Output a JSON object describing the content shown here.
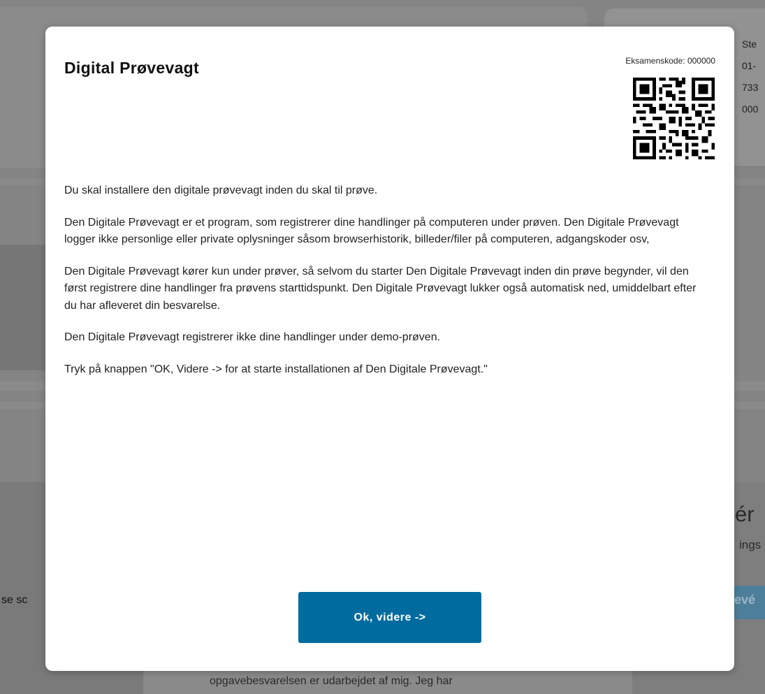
{
  "background": {
    "info_lines": [
      "Ste",
      "01-",
      "733",
      "000"
    ],
    "big_text": "ér",
    "small_text": "ings",
    "button_label": "evé",
    "left_text": "se sc",
    "bottom_text": "opgavebesvarelsen er udarbejdet af mig. Jeg har"
  },
  "modal": {
    "title": "Digital Prøvevagt",
    "exam_code_label": "Eksamenskode: 000000",
    "qr_icon": "qr-code-icon",
    "paragraphs": [
      "Du skal installere den digitale prøvevagt inden du skal til prøve.",
      "Den Digitale Prøvevagt er et program, som registrerer dine handlinger på computeren under prøven. Den Digitale Prøvevagt logger ikke personlige eller private oplysninger såsom browserhistorik, billeder/filer på computeren, adgangskoder osv,",
      "Den Digitale Prøvevagt kører kun under prøver, så selvom du starter Den Digitale Prøvevagt inden din prøve begynder, vil den først registrere dine handlinger fra prøvens starttidspunkt. Den Digitale Prøvevagt lukker også automatisk ned, umiddelbart efter du har afleveret din besvarelse.",
      "Den Digitale Prøvevagt registrerer ikke dine handlinger under demo-prøven.",
      "Tryk på knappen \"OK, Videre -> for at starte installationen af Den Digitale Prøvevagt.\""
    ],
    "ok_button_label": "Ok, videre ->"
  },
  "colors": {
    "overlay": "#848484",
    "button": "#006b9e",
    "modal_bg": "#ffffff"
  }
}
